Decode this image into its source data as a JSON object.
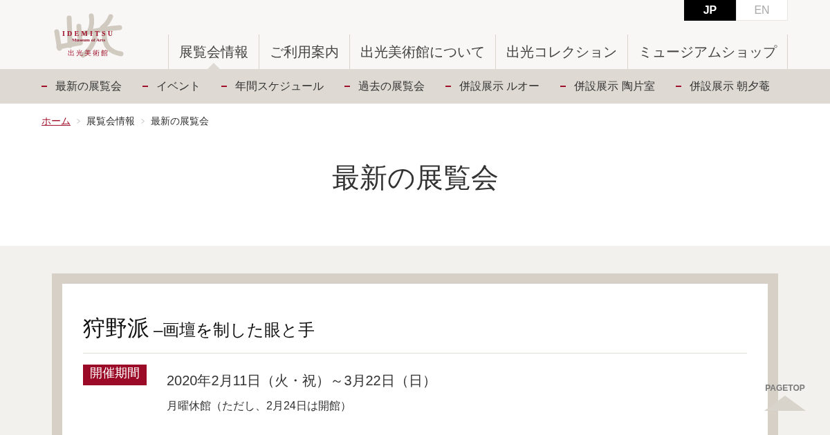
{
  "header": {
    "logo": {
      "wordmark": "IDEMITSU",
      "tagline": "Museum of Arts",
      "name_ja": "出光美術館"
    },
    "languages": [
      {
        "label": "JP",
        "selected": true
      },
      {
        "label": "EN",
        "selected": false
      }
    ],
    "main_nav": [
      {
        "label": "展覧会情報",
        "selected": true
      },
      {
        "label": "ご利用案内",
        "selected": false
      },
      {
        "label": "出光美術館について",
        "selected": false
      },
      {
        "label": "出光コレクション",
        "selected": false
      },
      {
        "label": "ミュージアムショップ",
        "selected": false
      }
    ]
  },
  "sub_nav": [
    {
      "label": "最新の展覧会"
    },
    {
      "label": "イベント"
    },
    {
      "label": "年間スケジュール"
    },
    {
      "label": "過去の展覧会"
    },
    {
      "label": "併設展示 ルオー"
    },
    {
      "label": "併設展示 陶片室"
    },
    {
      "label": "併設展示 朝夕菴"
    }
  ],
  "breadcrumb": [
    {
      "label": "ホーム",
      "kind": "link"
    },
    {
      "label": "展覧会情報",
      "kind": "text"
    },
    {
      "label": "最新の展覧会",
      "kind": "text"
    }
  ],
  "page_title": "最新の展覧会",
  "exhibition": {
    "title": "狩野派",
    "subtitle": "–画壇を制した眼と手",
    "period_label": "開催期間",
    "dates": "2020年2月11日（火・祝）～3月22日（日）",
    "note": "月曜休館（ただし、2月24日は開館）"
  },
  "page_top": {
    "label": "PAGETOP"
  }
}
